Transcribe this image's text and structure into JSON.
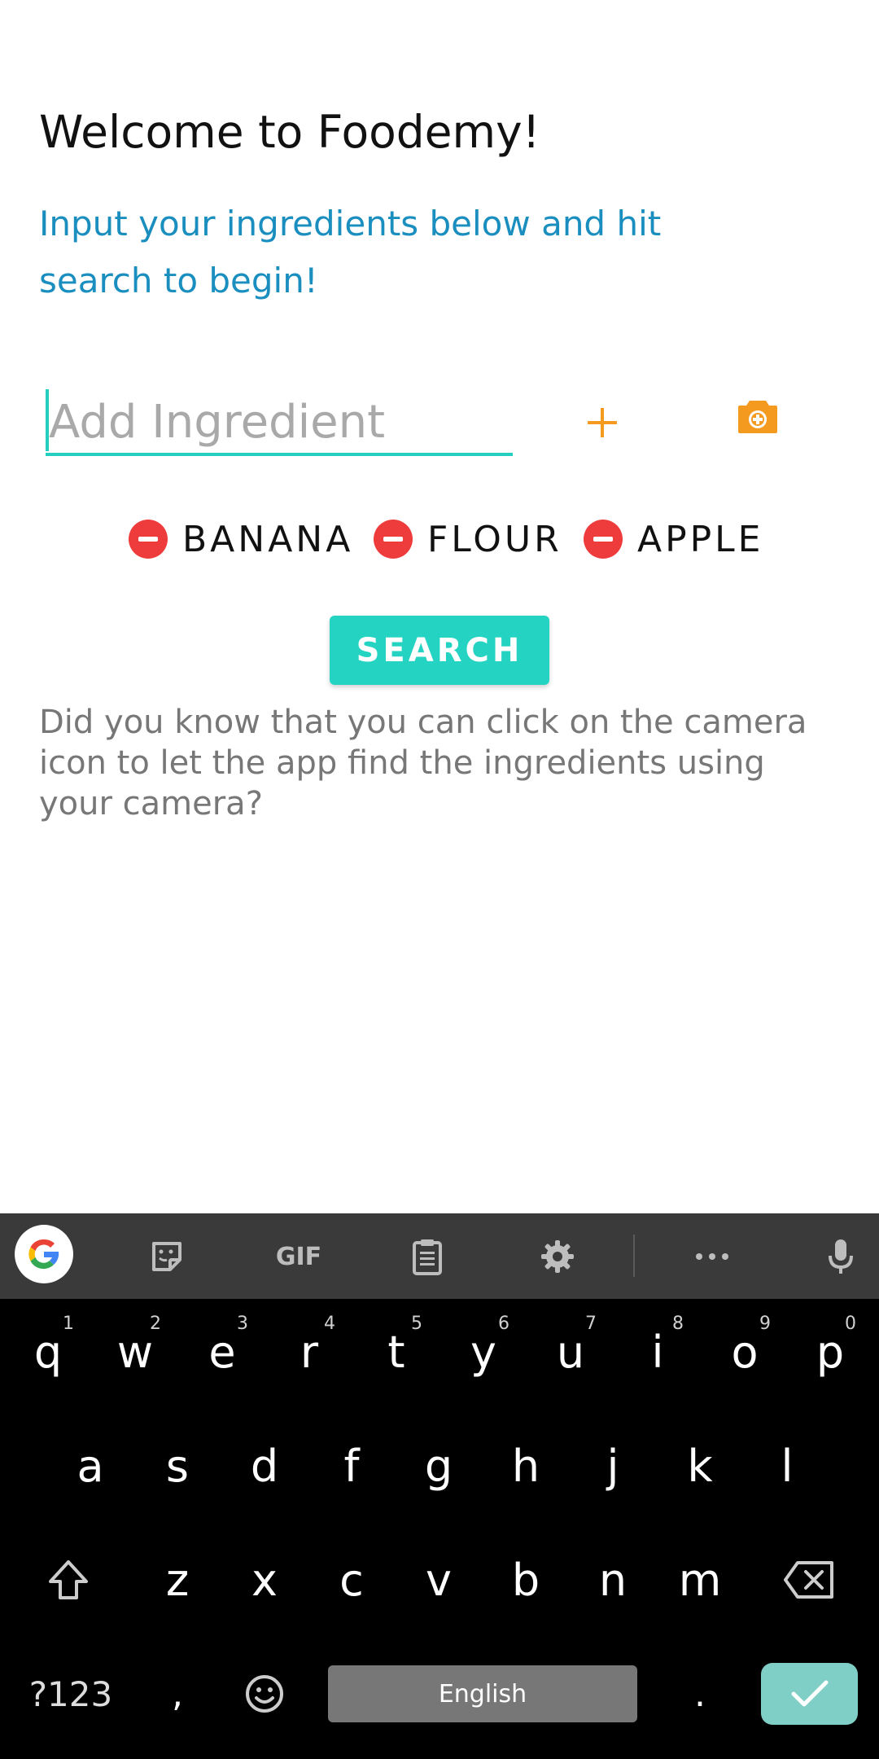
{
  "app": {
    "title": "Welcome to Foodemy!",
    "subtitle": "Input your ingredients below and hit search to begin!",
    "input_placeholder": "Add Ingredient",
    "input_value": "",
    "ingredients": [
      "BANANA",
      "FLOUR",
      "APPLE"
    ],
    "search_label": "SEARCH",
    "tip": "Did you know that you can click on the camera icon to let the app find the ingredients using your camera?",
    "icons": {
      "add": "plus-icon",
      "camera": "camera-icon",
      "remove": "minus-circle-icon"
    },
    "colors": {
      "accent": "#25d3c3",
      "orange": "#f39a1f",
      "subtitle": "#1a8fbf",
      "remove": "#ee3b3b"
    }
  },
  "keyboard": {
    "toolbar_icons": [
      "google-icon",
      "sticker-icon",
      "gif-icon",
      "clipboard-icon",
      "settings-icon",
      "more-icon",
      "mic-icon"
    ],
    "gif_label": "GIF",
    "row1": [
      {
        "k": "q",
        "h": "1"
      },
      {
        "k": "w",
        "h": "2"
      },
      {
        "k": "e",
        "h": "3"
      },
      {
        "k": "r",
        "h": "4"
      },
      {
        "k": "t",
        "h": "5"
      },
      {
        "k": "y",
        "h": "6"
      },
      {
        "k": "u",
        "h": "7"
      },
      {
        "k": "i",
        "h": "8"
      },
      {
        "k": "o",
        "h": "9"
      },
      {
        "k": "p",
        "h": "0"
      }
    ],
    "row2": [
      "a",
      "s",
      "d",
      "f",
      "g",
      "h",
      "j",
      "k",
      "l"
    ],
    "row3": [
      "z",
      "x",
      "c",
      "v",
      "b",
      "n",
      "m"
    ],
    "symbols_label": "?123",
    "comma_label": ",",
    "period_label": ".",
    "space_label": "English"
  }
}
